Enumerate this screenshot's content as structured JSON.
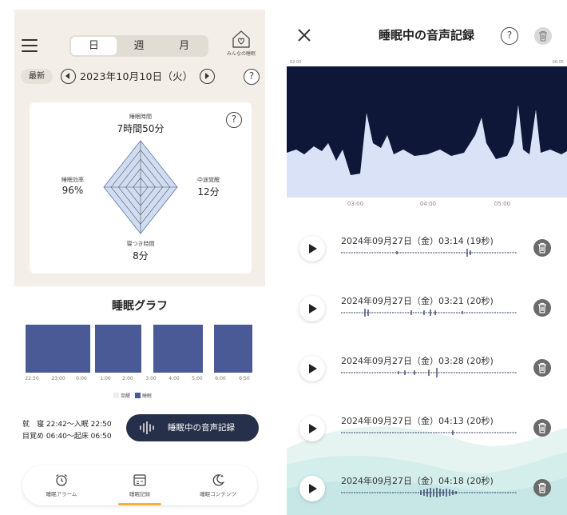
{
  "left": {
    "tabs": [
      {
        "label": "日"
      },
      {
        "label": "週"
      },
      {
        "label": "月"
      }
    ],
    "home_label": "みんなの睡眠",
    "latest_button": "最新",
    "date": "2023年10月10日（火）",
    "help_glyph": "?",
    "radar": {
      "top": {
        "name": "睡眠時間",
        "value": "7時間50分"
      },
      "left": {
        "name": "睡眠効率",
        "value": "96%"
      },
      "right": {
        "name": "中途覚醒",
        "value": "12分"
      },
      "bottom": {
        "name": "寝つき時間",
        "value": "8分"
      }
    },
    "graph": {
      "title": "睡眠グラフ",
      "ticks": [
        "22:50",
        "23:00",
        "0:00",
        "1:00",
        "2:00",
        "3:00",
        "4:00",
        "5:00",
        "6:00",
        "6:50"
      ],
      "legend_awake": "覚醒",
      "legend_sleep": "睡眠",
      "bedtime_line": "就　寝 22:42〜入眠 22:50",
      "wake_line": "目覚め 06:40〜起床 06:50",
      "record_button": "睡眠中の音声記録"
    },
    "nav": [
      {
        "label": "睡眠アラーム",
        "icon": "alarm-clock-icon"
      },
      {
        "label": "睡眠記録",
        "icon": "calendar-icon"
      },
      {
        "label": "睡眠コンテンツ",
        "icon": "moon-stars-icon"
      }
    ],
    "colors": {
      "sleep_bar": "#4a5a96",
      "active_underline": "#f2b33a",
      "record_pill": "#26304a"
    }
  },
  "right": {
    "title": "睡眠中の音声記録",
    "help_glyph": "?",
    "wave_start": "02:00",
    "wave_end": "06:05",
    "axis_ticks": [
      "03:00",
      "04:00",
      "05:00"
    ],
    "recordings": [
      {
        "label": "2024年09月27日（金）03:14 (19秒)"
      },
      {
        "label": "2024年09月27日（金）03:21 (20秒)"
      },
      {
        "label": "2024年09月27日（金）03:28 (20秒)"
      },
      {
        "label": "2024年09月27日（金）04:13 (20秒)"
      },
      {
        "label": "2024年09月27日（金）04:18 (20秒)"
      }
    ],
    "colors": {
      "wave_bg": "#0f1738",
      "wave_fill": "#d9e2f7"
    }
  }
}
